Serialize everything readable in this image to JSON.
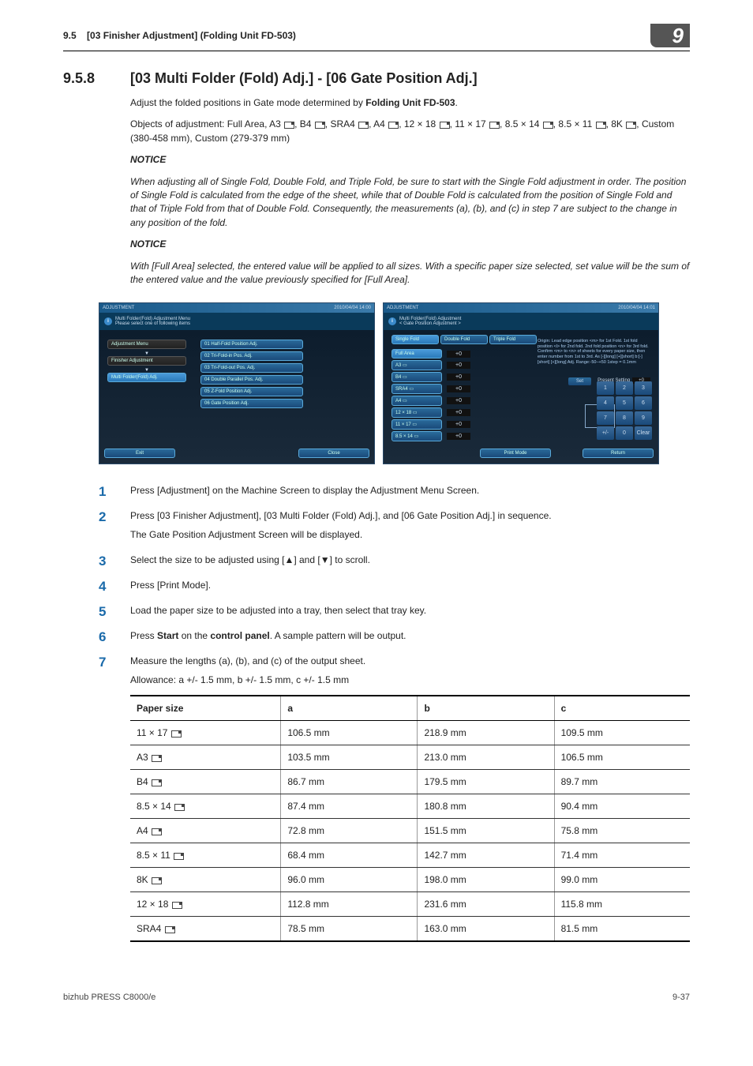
{
  "header": {
    "section_ref": "9.5",
    "section_title": "[03 Finisher Adjustment] (Folding Unit FD-503)",
    "chapter_num": "9"
  },
  "title": {
    "num": "9.5.8",
    "text": "[03 Multi Folder (Fold) Adj.] - [06 Gate Position Adj.]"
  },
  "intro": {
    "p1_a": "Adjust the folded positions in Gate mode determined by ",
    "p1_b": "Folding Unit FD-503",
    "p1_c": ".",
    "p2": "Objects of adjustment: Full Area, A3 ▭, B4 ▭, SRA4 ▭, A4 ▭, 12 × 18 ▭, 11 × 17 ▭, 8.5 × 14 ▭, 8.5 × 11 ▭, 8K ▭, Custom (380-458 mm), Custom (279-379 mm)"
  },
  "notice1": {
    "heading": "NOTICE",
    "body": "When adjusting all of Single Fold, Double Fold, and Triple Fold, be sure to start with the Single Fold adjustment in order. The position of Single Fold is calculated from the edge of the sheet, while that of Double Fold is calculated from the position of Single Fold and that of Triple Fold from that of Double Fold. Consequently, the measurements (a), (b), and (c) in step 7 are subject to the change in any position of the fold."
  },
  "notice2": {
    "heading": "NOTICE",
    "body": "With [Full Area] selected, the entered value will be applied to all sizes. With a specific paper size selected, set value will be the sum of the entered value and the value previously specified for [Full Area]."
  },
  "screen_left": {
    "topbar_left": "ADJUSTMENT",
    "topbar_right": "2010/04/04 14:00",
    "sub1": "Multi Folder(Fold) Adjustment Menu",
    "sub2": "Please select one of following items",
    "nav1": "Adjustment Menu",
    "nav2": "▼",
    "nav3": "Finisher Adjustment",
    "nav4": "▼",
    "nav5": "Multi Folder(Fold) Adj.",
    "m1": "01 Half-Fold Position Adj.",
    "m2": "02 Tri-Fold-in Pos. Adj.",
    "m3": "03 Tri-Fold-out Pos. Adj.",
    "m4": "04 Double Parallel Pos. Adj.",
    "m5": "05 Z-Fold Position Adj.",
    "m6": "06 Gate Position Adj.",
    "btn_exit": "Exit",
    "btn_close": "Close"
  },
  "screen_right": {
    "topbar_left": "ADJUSTMENT",
    "topbar_right": "2010/04/04 14:01",
    "sub1": "Multi Folder(Fold) Adjustment",
    "sub2": "< Gate Position Adjustment >",
    "tab1": "Single Fold",
    "tab2": "Double Fold",
    "tab3": "Triple Fold",
    "s1": "Full Area",
    "s2": "A3 ▭",
    "s3": "B4 ▭",
    "s4": "SRA4 ▭",
    "s5": "A4 ▭",
    "s6": "12 × 18 ▭",
    "s7": "11 × 17 ▭",
    "s8": "8.5 × 14 ▭",
    "v": "+0",
    "help": "Origin: Lead edge position <m> for 1st Fold. 1st fold position <l> for 2nd fold. 2nd fold position <n> for 3rd fold. Confirm <m> to <n> of sheets for every paper size, then enter number from 1st to 3rd.\nAs [-][long] [+][short] b:[-][short] [+][long]\nAdj. Range:-50–+50 1step = 0.1mm",
    "set": "Set",
    "present": "Present Setting",
    "present_val": "+0",
    "kp": [
      "1",
      "2",
      "3",
      "4",
      "5",
      "6",
      "7",
      "8",
      "9",
      "+/-",
      "0",
      "Clear"
    ],
    "btn_print": "Print Mode",
    "btn_return": "Return"
  },
  "steps": {
    "s1": "Press [Adjustment] on the Machine Screen to display the Adjustment Menu Screen.",
    "s2a": "Press [03 Finisher Adjustment], [03 Multi Folder (Fold) Adj.], and [06 Gate Position Adj.] in sequence.",
    "s2b": "The Gate Position Adjustment Screen will be displayed.",
    "s3": "Select the size to be adjusted using [▲] and [▼] to scroll.",
    "s4": "Press [Print Mode].",
    "s5": "Load the paper size to be adjusted into a tray, then select that tray key.",
    "s6a": "Press ",
    "s6b": "Start",
    "s6c": " on the ",
    "s6d": "control panel",
    "s6e": ". A sample pattern will be output.",
    "s7a": "Measure the lengths (a), (b), and (c) of the output sheet.",
    "s7b": "Allowance: a +/- 1.5 mm, b +/- 1.5 mm, c +/- 1.5 mm"
  },
  "table": {
    "h1": "Paper size",
    "h2": "a",
    "h3": "b",
    "h4": "c",
    "rows": [
      {
        "size": "11 × 17",
        "a": "106.5 mm",
        "b": "218.9 mm",
        "c": "109.5 mm"
      },
      {
        "size": "A3",
        "a": "103.5 mm",
        "b": "213.0 mm",
        "c": "106.5 mm"
      },
      {
        "size": "B4",
        "a": "86.7 mm",
        "b": "179.5 mm",
        "c": "89.7 mm"
      },
      {
        "size": "8.5 × 14",
        "a": "87.4 mm",
        "b": "180.8 mm",
        "c": "90.4 mm"
      },
      {
        "size": "A4",
        "a": "72.8 mm",
        "b": "151.5 mm",
        "c": "75.8 mm"
      },
      {
        "size": "8.5 × 11",
        "a": "68.4 mm",
        "b": "142.7 mm",
        "c": "71.4 mm"
      },
      {
        "size": "8K",
        "a": "96.0 mm",
        "b": "198.0 mm",
        "c": "99.0 mm"
      },
      {
        "size": "12 × 18",
        "a": "112.8 mm",
        "b": "231.6 mm",
        "c": "115.8 mm"
      },
      {
        "size": "SRA4",
        "a": "78.5 mm",
        "b": "163.0 mm",
        "c": "81.5 mm"
      }
    ]
  },
  "footer": {
    "left": "bizhub PRESS C8000/e",
    "right": "9-37"
  }
}
